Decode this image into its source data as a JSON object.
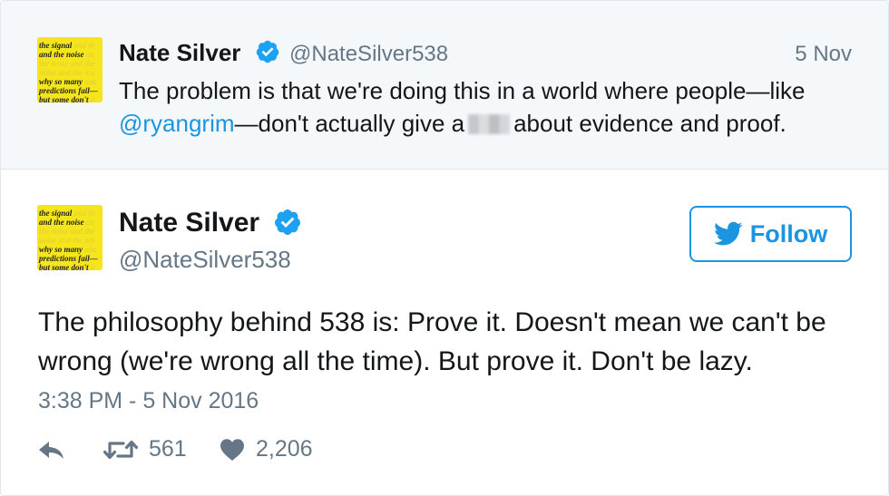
{
  "parent_tweet": {
    "name": "Nate Silver",
    "handle": "@NateSilver538",
    "date": "5 Nov",
    "text_part1": "The problem is that we're doing this in a world where people—like",
    "mention": "@ryangrim",
    "text_part2": "—don't actually give a",
    "text_part3": "about evidence and proof."
  },
  "avatar_lines": [
    [
      "the signal",
      " and th"
    ],
    [
      "and the noise",
      " an"
    ],
    [
      "",
      "the noise and the"
    ],
    [
      "",
      "noise and the noi"
    ],
    [
      "why so many",
      " ana"
    ],
    [
      "predictions fail—",
      ""
    ],
    [
      "but some don't",
      " it"
    ]
  ],
  "main_tweet": {
    "name": "Nate Silver",
    "handle": "@NateSilver538",
    "follow_label": "Follow",
    "text": "The philosophy behind 538 is: Prove it. Doesn't mean we can't be wrong (we're wrong all the time). But prove it. Don't be lazy.",
    "timestamp": "3:38 PM - 5 Nov 2016",
    "retweets": "561",
    "likes": "2,206"
  },
  "colors": {
    "link": "#1b95e0",
    "verified": "#1da1f2",
    "muted": "#657786",
    "avatar_bg": "#f5e51c"
  },
  "icons": [
    "verified-badge-icon",
    "twitter-bird-icon",
    "reply-icon",
    "retweet-icon",
    "heart-icon"
  ]
}
